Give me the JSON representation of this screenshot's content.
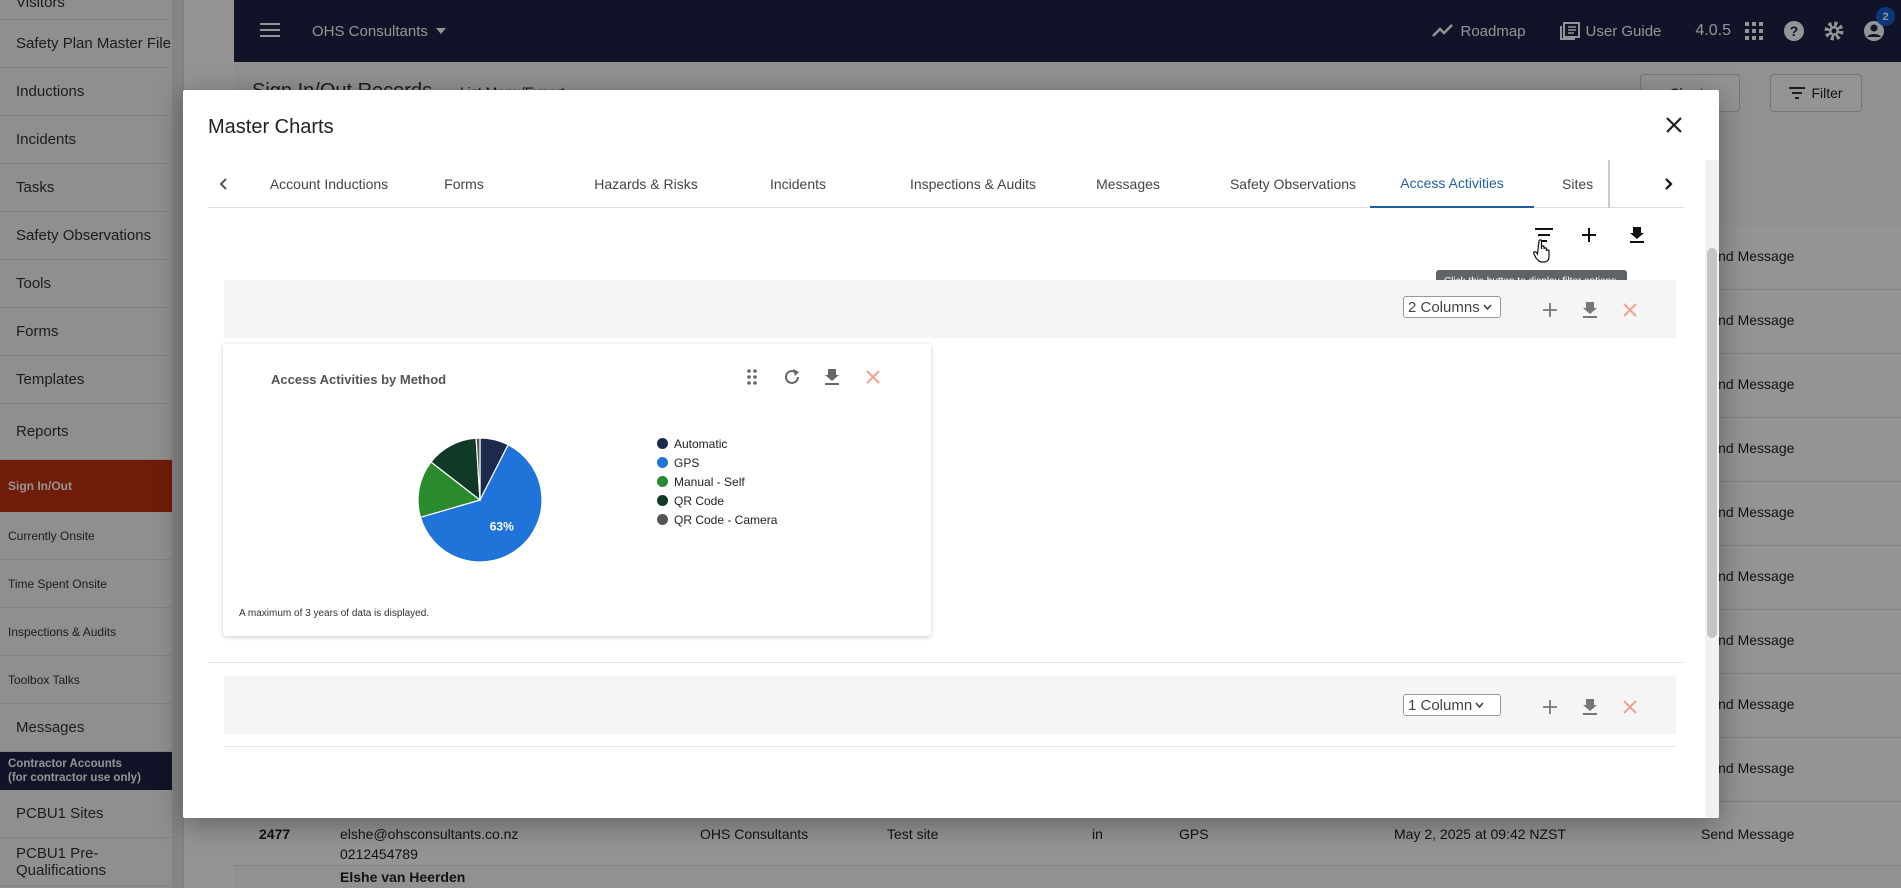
{
  "sidebar": {
    "items": [
      "Visitors",
      "Safety Plan Master File",
      "Inductions",
      "Incidents",
      "Tasks",
      "Safety Observations",
      "Tools",
      "Forms",
      "Templates",
      "Reports"
    ],
    "section_label": "Sign In/Out",
    "sub_items": [
      "Currently Onsite",
      "Time Spent Onsite",
      "Inspections & Audits",
      "Toolbox Talks"
    ],
    "messages": "Messages",
    "contractor_line1": "Contractor Accounts",
    "contractor_line2": "(for contractor use only)",
    "pcbu_items": [
      "PCBU1 Sites",
      "PCBU1 Pre-Qualifications"
    ]
  },
  "topbar": {
    "company": "OHS Consultants",
    "roadmap": "Roadmap",
    "user_guide": "User Guide",
    "version": "4.0.5",
    "badge": "2"
  },
  "background": {
    "page_title": "Sign In/Out Records",
    "list_menu": "List Menu/Export",
    "charts_btn": "Charts",
    "filter_btn": "Filter",
    "send_message": "Send Message",
    "last_row": {
      "id": "2477",
      "email": "elshe@ohsconsultants.co.nz",
      "phone": "0212454789",
      "company": "OHS Consultants",
      "site": "Test site",
      "status": "in",
      "method": "GPS",
      "date": "May 2, 2025 at 09:42 NZST",
      "action": "Send Message",
      "next_name": "Elshe van Heerden"
    }
  },
  "modal": {
    "title": "Master Charts",
    "tabs": [
      "Account Inductions",
      "Forms",
      "Hazards & Risks",
      "Incidents",
      "Inspections & Audits",
      "Messages",
      "Safety Observations",
      "Access Activities",
      "Sites"
    ],
    "active_tab": "Access Activities",
    "tooltip": "Click this button to display filter options.",
    "row1_columns": "2 Columns",
    "row2_columns": "1 Column"
  },
  "chart_card": {
    "title": "Access Activities by Method",
    "note": "A maximum of 3 years of data is displayed.",
    "slice_label": "63%"
  },
  "chart_data": {
    "type": "pie",
    "title": "Access Activities by Method",
    "labels": [
      "Automatic",
      "GPS",
      "Manual - Self",
      "QR Code",
      "QR Code - Camera"
    ],
    "values": [
      7.5,
      63,
      15,
      13.5,
      1
    ],
    "colors": [
      "#1b2b4b",
      "#1f73d9",
      "#2a8a2e",
      "#0f3a27",
      "#555555"
    ],
    "legend": "right"
  },
  "colors": {
    "navy": "#1e2245",
    "brand_orange": "#c0310e",
    "accent_blue": "#1f5f9e",
    "close_red": "#f0a38f"
  }
}
